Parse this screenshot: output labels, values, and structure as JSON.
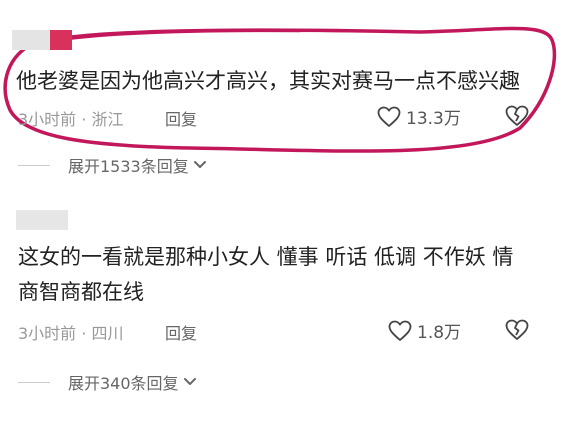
{
  "colors": {
    "highlight_circle": "#c2185b",
    "text_primary": "#222222",
    "text_meta": "#999999",
    "text_secondary": "#666666"
  },
  "comments": [
    {
      "text_lines": [
        "他老婆是因为他高兴才高兴，其实对赛马一点不感兴趣"
      ],
      "meta": "3小时前 · 浙江",
      "reply_label": "回复",
      "like_count": "13.3万",
      "like_icon": "heart-outline-icon",
      "dislike_icon": "broken-heart-icon",
      "expand_label": "展开1533条回复"
    },
    {
      "text_lines": [
        "这女的一看就是那种小女人 懂事 听话 低调 不作妖 情",
        "商智商都在线"
      ],
      "meta": "3小时前 · 四川",
      "reply_label": "回复",
      "like_count": "1.8万",
      "like_icon": "heart-outline-icon",
      "dislike_icon": "broken-heart-icon",
      "expand_label": "展开340条回复"
    }
  ]
}
